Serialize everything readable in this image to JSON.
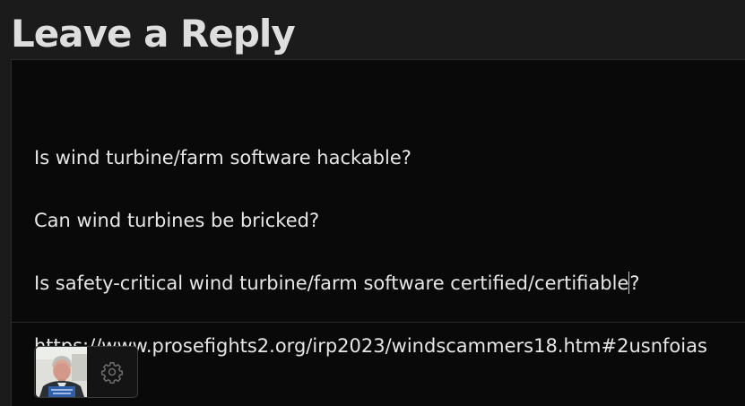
{
  "heading": "Leave a Reply",
  "comment": {
    "paragraphs": [
      "Is wind turbine/farm software hackable?",
      "Can wind turbines be bricked?",
      "https://www.prosefights2.org/irp2023/windscammers18.htm#2usnfoias"
    ],
    "caret_paragraph": {
      "before_caret": "Is safety-critical wind turbine/farm software certified/certifiable",
      "after_caret": "?"
    }
  },
  "toolbar": {
    "avatar_icon": "user-avatar",
    "settings_icon": "gear-icon"
  },
  "colors": {
    "page_background": "#1b1b1b",
    "editor_background": "#090909",
    "text": "#e6e6e6",
    "heading": "#dedede"
  }
}
